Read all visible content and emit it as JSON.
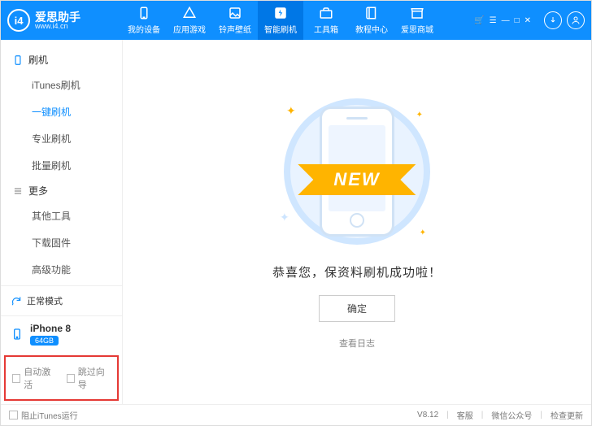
{
  "brand": {
    "name": "爱思助手",
    "url": "www.i4.cn",
    "badge": "i4"
  },
  "tabs": [
    {
      "label": "我的设备"
    },
    {
      "label": "应用游戏"
    },
    {
      "label": "铃声壁纸"
    },
    {
      "label": "智能刷机"
    },
    {
      "label": "工具箱"
    },
    {
      "label": "教程中心"
    },
    {
      "label": "爱思商城"
    }
  ],
  "sidebar": {
    "sections": [
      {
        "title": "刷机",
        "items": [
          "iTunes刷机",
          "一键刷机",
          "专业刷机",
          "批量刷机"
        ],
        "active": 1
      },
      {
        "title": "更多",
        "items": [
          "其他工具",
          "下载固件",
          "高级功能"
        ]
      }
    ],
    "status": "正常模式",
    "device": {
      "name": "iPhone 8",
      "storage": "64GB"
    },
    "checks": {
      "a": "自动激活",
      "b": "跳过向导"
    }
  },
  "main": {
    "ribbon": "NEW",
    "message": "恭喜您，保资料刷机成功啦！",
    "ok": "确定",
    "log": "查看日志"
  },
  "footer": {
    "block_itunes": "阻止iTunes运行",
    "version": "V8.12",
    "support": "客服",
    "wechat": "微信公众号",
    "update": "检查更新"
  }
}
